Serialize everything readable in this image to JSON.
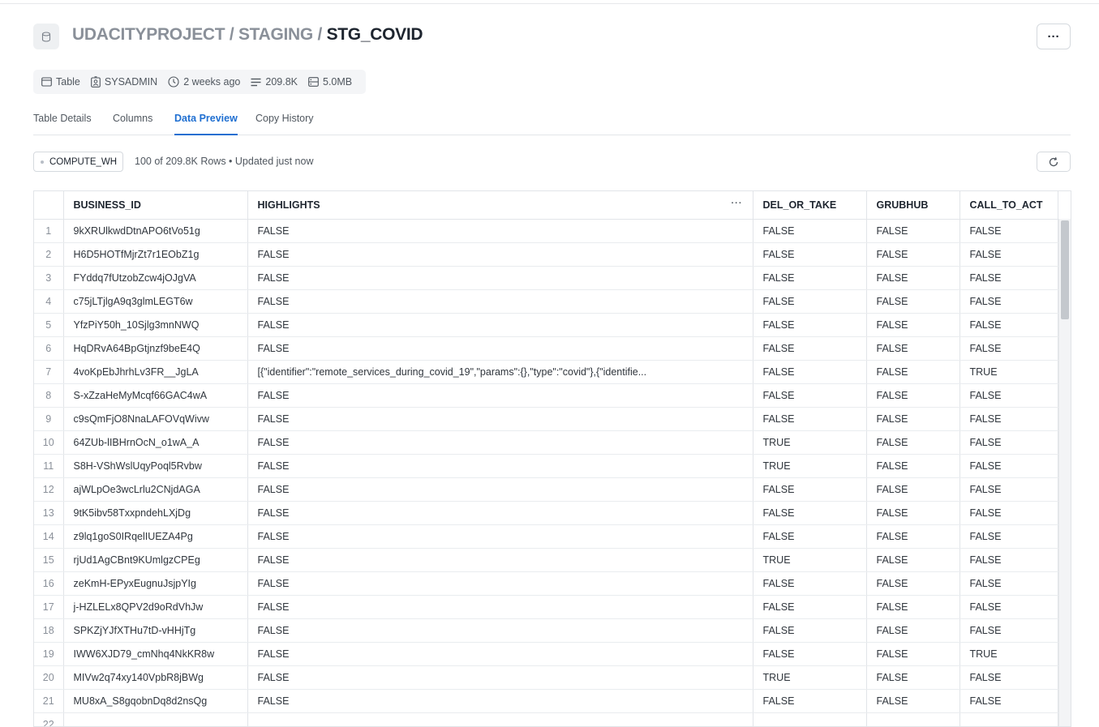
{
  "breadcrumb": {
    "db": "UDACITYPROJECT",
    "sep1": " / ",
    "schema": "STAGING",
    "sep2": " / ",
    "table": "STG_COVID"
  },
  "more_label": "···",
  "meta": {
    "type": "Table",
    "owner": "SYSADMIN",
    "age": "2 weeks ago",
    "rows": "209.8K",
    "size": "5.0MB"
  },
  "tabs": [
    {
      "label": "Table Details"
    },
    {
      "label": "Columns"
    },
    {
      "label": "Data Preview",
      "active": true
    },
    {
      "label": "Copy History"
    }
  ],
  "warehouse": "COMPUTE_WH",
  "rows_info": "100 of 209.8K Rows • Updated just now",
  "colors": {
    "accent": "#1f6fd1",
    "text": "#1e252f",
    "muted": "#50575f",
    "border": "#e1e4e8"
  },
  "table": {
    "columns": [
      "BUSINESS_ID",
      "HIGHLIGHTS",
      "DEL_OR_TAKE",
      "GRUBHUB",
      "CALL_TO_ACT"
    ],
    "rows": [
      [
        "1",
        "9kXRUlkwdDtnAPO6tVo51g",
        "FALSE",
        "FALSE",
        "FALSE",
        "FALSE"
      ],
      [
        "2",
        "H6D5HOTfMjrZt7r1EObZ1g",
        "FALSE",
        "FALSE",
        "FALSE",
        "FALSE"
      ],
      [
        "3",
        "FYddq7fUtzobZcw4jOJgVA",
        "FALSE",
        "FALSE",
        "FALSE",
        "FALSE"
      ],
      [
        "4",
        "c75jLTjlgA9q3glmLEGT6w",
        "FALSE",
        "FALSE",
        "FALSE",
        "FALSE"
      ],
      [
        "5",
        "YfzPiY50h_10Sjlg3mnNWQ",
        "FALSE",
        "FALSE",
        "FALSE",
        "FALSE"
      ],
      [
        "6",
        "HqDRvA64BpGtjnzf9beE4Q",
        "FALSE",
        "FALSE",
        "FALSE",
        "FALSE"
      ],
      [
        "7",
        "4voKpEbJhrhLv3FR__JgLA",
        "[{\"identifier\":\"remote_services_during_covid_19\",\"params\":{},\"type\":\"covid\"},{\"identifie...",
        "FALSE",
        "FALSE",
        "TRUE"
      ],
      [
        "8",
        "S-xZzaHeMyMcqf66GAC4wA",
        "FALSE",
        "FALSE",
        "FALSE",
        "FALSE"
      ],
      [
        "9",
        "c9sQmFjO8NnaLAFOVqWivw",
        "FALSE",
        "FALSE",
        "FALSE",
        "FALSE"
      ],
      [
        "10",
        "64ZUb-lIBHrnOcN_o1wA_A",
        "FALSE",
        "TRUE",
        "FALSE",
        "FALSE"
      ],
      [
        "11",
        "S8H-VShWslUqyPoql5Rvbw",
        "FALSE",
        "TRUE",
        "FALSE",
        "FALSE"
      ],
      [
        "12",
        "ajWLpOe3wcLrlu2CNjdAGA",
        "FALSE",
        "FALSE",
        "FALSE",
        "FALSE"
      ],
      [
        "13",
        "9tK5ibv58TxxpndehLXjDg",
        "FALSE",
        "FALSE",
        "FALSE",
        "FALSE"
      ],
      [
        "14",
        "z9lq1goS0IRqelIUEZA4Pg",
        "FALSE",
        "FALSE",
        "FALSE",
        "FALSE"
      ],
      [
        "15",
        "rjUd1AgCBnt9KUmlgzCPEg",
        "FALSE",
        "TRUE",
        "FALSE",
        "FALSE"
      ],
      [
        "16",
        "zeKmH-EPyxEugnuJsjpYIg",
        "FALSE",
        "FALSE",
        "FALSE",
        "FALSE"
      ],
      [
        "17",
        "j-HZLELx8QPV2d9oRdVhJw",
        "FALSE",
        "FALSE",
        "FALSE",
        "FALSE"
      ],
      [
        "18",
        "SPKZjYJfXTHu7tD-vHHjTg",
        "FALSE",
        "FALSE",
        "FALSE",
        "FALSE"
      ],
      [
        "19",
        "IWW6XJD79_cmNhq4NkKR8w",
        "FALSE",
        "FALSE",
        "FALSE",
        "TRUE"
      ],
      [
        "20",
        "MIVw2q74xy140VpbR8jBWg",
        "FALSE",
        "TRUE",
        "FALSE",
        "FALSE"
      ],
      [
        "21",
        "MU8xA_S8gqobnDq8d2nsQg",
        "FALSE",
        "FALSE",
        "FALSE",
        "FALSE"
      ],
      [
        "22",
        "",
        "",
        "",
        "",
        ""
      ]
    ]
  }
}
